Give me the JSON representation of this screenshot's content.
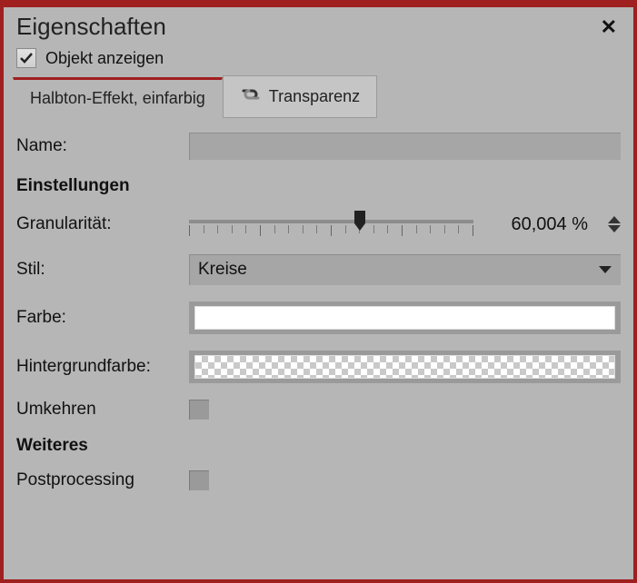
{
  "header": {
    "title": "Eigenschaften"
  },
  "showObject": {
    "label": "Objekt anzeigen",
    "checked": true
  },
  "tabs": {
    "halftone": {
      "label": "Halbton-Effekt, einfarbig",
      "active": true
    },
    "transparency": {
      "label": "Transparenz",
      "active": false
    }
  },
  "fields": {
    "name": {
      "label": "Name:",
      "value": ""
    },
    "sectionSettings": "Einstellungen",
    "granularity": {
      "label": "Granularität:",
      "value": 60.004,
      "display": "60,004 %"
    },
    "style": {
      "label": "Stil:",
      "value": "Kreise"
    },
    "color": {
      "label": "Farbe:",
      "value": "#ffffff"
    },
    "bgcolor": {
      "label": "Hintergrundfarbe:",
      "value": "transparent"
    },
    "invert": {
      "label": "Umkehren",
      "checked": false
    },
    "sectionMore": "Weiteres",
    "postprocessing": {
      "label": "Postprocessing",
      "checked": false
    }
  }
}
